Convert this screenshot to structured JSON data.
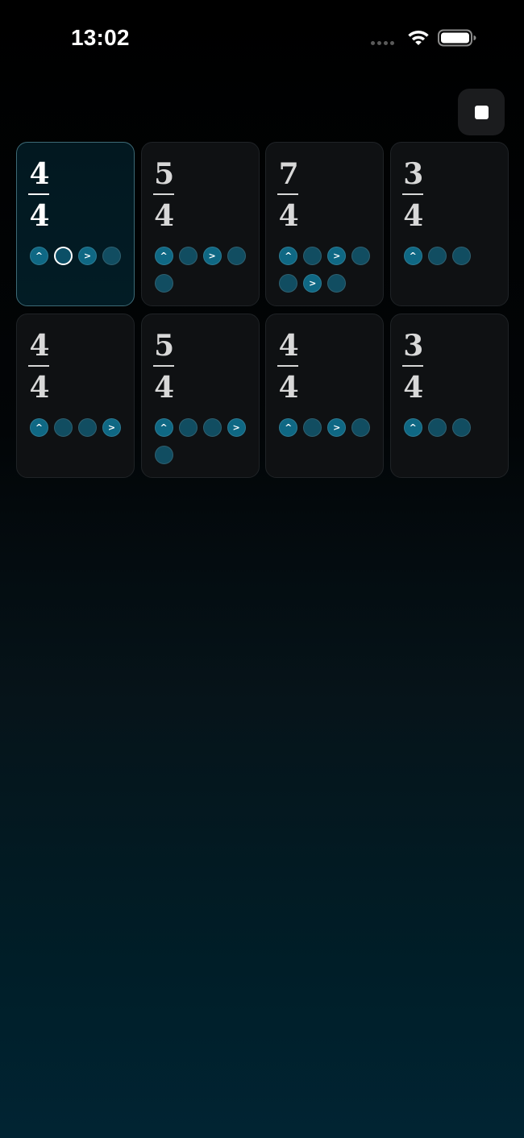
{
  "status_bar": {
    "time": "13:02",
    "icons": [
      "signal-dots-icon",
      "wifi-icon",
      "battery-icon"
    ]
  },
  "toolbar": {
    "stop_icon": "stop-icon"
  },
  "colors": {
    "beat_normal": "#114d61",
    "beat_accent": "#0f6884",
    "active_card_border": "#3d6a76",
    "card_background": "#0f1113"
  },
  "measures": [
    {
      "numerator": "4",
      "denominator": "4",
      "active": true,
      "beats": [
        {
          "type": "up",
          "label": "^"
        },
        {
          "type": "current",
          "label": ""
        },
        {
          "type": "right",
          "label": ">"
        },
        {
          "type": "normal",
          "label": ""
        }
      ]
    },
    {
      "numerator": "5",
      "denominator": "4",
      "active": false,
      "beats": [
        {
          "type": "up",
          "label": "^"
        },
        {
          "type": "normal",
          "label": ""
        },
        {
          "type": "right",
          "label": ">"
        },
        {
          "type": "normal",
          "label": ""
        },
        {
          "type": "normal",
          "label": ""
        }
      ]
    },
    {
      "numerator": "7",
      "denominator": "4",
      "active": false,
      "beats": [
        {
          "type": "up",
          "label": "^"
        },
        {
          "type": "normal",
          "label": ""
        },
        {
          "type": "right",
          "label": ">"
        },
        {
          "type": "normal",
          "label": ""
        },
        {
          "type": "normal",
          "label": ""
        },
        {
          "type": "right",
          "label": ">"
        },
        {
          "type": "normal",
          "label": ""
        }
      ]
    },
    {
      "numerator": "3",
      "denominator": "4",
      "active": false,
      "beats": [
        {
          "type": "up",
          "label": "^"
        },
        {
          "type": "normal",
          "label": ""
        },
        {
          "type": "normal",
          "label": ""
        }
      ]
    },
    {
      "numerator": "4",
      "denominator": "4",
      "active": false,
      "beats": [
        {
          "type": "up",
          "label": "^"
        },
        {
          "type": "normal",
          "label": ""
        },
        {
          "type": "normal",
          "label": ""
        },
        {
          "type": "right",
          "label": ">"
        }
      ]
    },
    {
      "numerator": "5",
      "denominator": "4",
      "active": false,
      "beats": [
        {
          "type": "up",
          "label": "^"
        },
        {
          "type": "normal",
          "label": ""
        },
        {
          "type": "normal",
          "label": ""
        },
        {
          "type": "right",
          "label": ">"
        },
        {
          "type": "normal",
          "label": ""
        }
      ]
    },
    {
      "numerator": "4",
      "denominator": "4",
      "active": false,
      "beats": [
        {
          "type": "up",
          "label": "^"
        },
        {
          "type": "normal",
          "label": ""
        },
        {
          "type": "right",
          "label": ">"
        },
        {
          "type": "normal",
          "label": ""
        }
      ]
    },
    {
      "numerator": "3",
      "denominator": "4",
      "active": false,
      "beats": [
        {
          "type": "up",
          "label": "^"
        },
        {
          "type": "normal",
          "label": ""
        },
        {
          "type": "normal",
          "label": ""
        }
      ]
    }
  ]
}
